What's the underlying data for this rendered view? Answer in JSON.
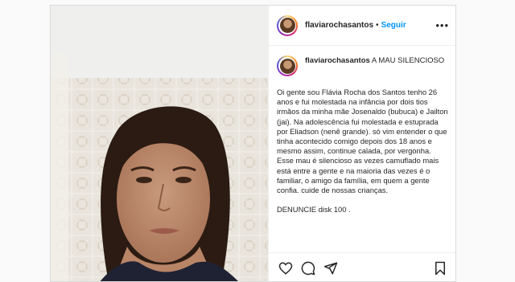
{
  "post": {
    "username": "flaviarochasantos",
    "separator": "•",
    "follow_label": "Seguir",
    "more_label": "•••",
    "caption_title": "A MAU SILENCIOSO",
    "caption_body": "Oi gente sou Flávia Rocha dos Santos tenho 26 anos e fui molestada na infância por dois tios irmãos da minha mãe Josenaldo (bubuca) e Jailton (jai). Na adolescência fui molestada e estuprada por Eliadson (nenê grande). só vim entender o que tinha acontecido comigo depois dos 18 anos e mesmo assim, continue calada, por vergonha.\nEsse mau é silencioso as vezes camuflado mais está entre a gente e na maioria das vezes é o familiar, o amigo da família, em quem a gente confia. cuide de nossas crianças.\n\nDENUNCIE disk 100 ."
  },
  "icons": {
    "like": "heart-icon",
    "comment": "comment-icon",
    "share": "share-icon",
    "save": "bookmark-icon",
    "more": "more-options-icon"
  },
  "colors": {
    "follow": "#0095f6",
    "text": "#262626",
    "border": "#dbdbdb"
  }
}
